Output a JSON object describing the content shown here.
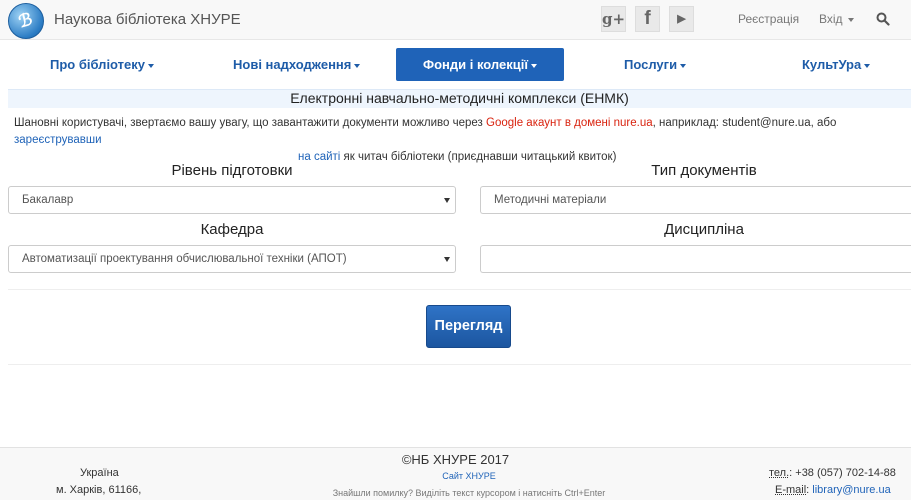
{
  "header": {
    "logo_glyph": "ℬ",
    "site_title": "Наукова бібліотека ХНУРЕ",
    "social": {
      "google": "g+",
      "facebook": "f",
      "youtube": "▶"
    },
    "register": "Реєстрація",
    "login": "Вхід"
  },
  "nav": {
    "items": [
      {
        "label": "Про бібліотеку"
      },
      {
        "label": "Нові надходження"
      },
      {
        "label": "Фонди і колекції"
      },
      {
        "label": "Послуги"
      },
      {
        "label": "КультУра"
      }
    ],
    "active_color": "#1f63b8"
  },
  "section": {
    "title": "Електронні навчально-методичні комплекси (ЕНМК)"
  },
  "notice": {
    "text_1": "Шановні користувачі, звертаємо вашу увагу, що завантажити документи можливо через ",
    "red_text": "Google акаунт в домені nure.ua",
    "text_2": ", наприклад: student@nure.ua, або ",
    "link_1": "зареєструвавши",
    "link_2": "на сайті",
    "text_3": " як читач бібліотеки (приєднавши читацький квиток)"
  },
  "form": {
    "level_label": "Рівень підготовки",
    "level_value": "Бакалавр",
    "doctype_label": "Тип документів",
    "doctype_value": "Методичні матеріали",
    "dept_label": "Кафедра",
    "dept_value": "Автоматизації проектування обчислювальної техніки (АПОТ)",
    "discipline_label": "Дисципліна",
    "discipline_value": "",
    "view_button": "Перегляд"
  },
  "footer": {
    "copyright": "©НБ ХНУРЕ 2017",
    "site_link": "Сайт ХНУРЕ",
    "hint": "Знайшли помилку? Виділіть текст курсором і натисніть Ctrl+Enter",
    "country": "Україна",
    "city": "м. Харків, 61166,",
    "tel_label": "тел.",
    "tel_value": ": +38 (057) 702-14-88",
    "email_label": "E-mail",
    "email_value": "library@nure.ua"
  }
}
